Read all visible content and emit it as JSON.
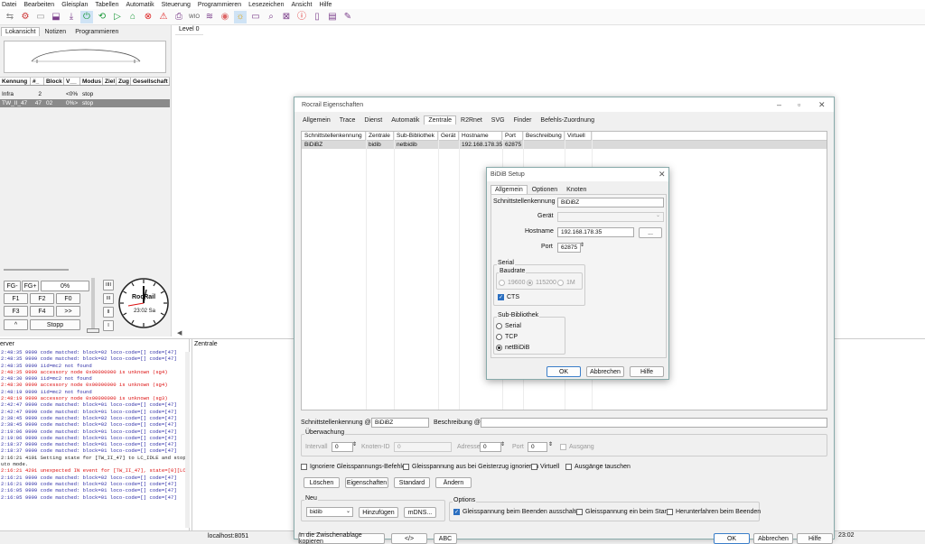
{
  "menu": [
    "Datei",
    "Bearbeiten",
    "Gleisplan",
    "Tabellen",
    "Automatik",
    "Steuerung",
    "Programmieren",
    "Lesezeichen",
    "Ansicht",
    "Hilfe"
  ],
  "toolbar_icons": [
    "link-icon",
    "folder-icon",
    "open-icon",
    "save-icon",
    "download-icon",
    "power-icon",
    "refresh-icon",
    "play-icon",
    "home-icon",
    "stop-icon",
    "warning-icon",
    "print-icon",
    "wio-icon",
    "sliders-icon",
    "eye-icon",
    "sun-icon",
    "monitor-icon",
    "search-icon",
    "grid-icon",
    "info-icon",
    "clipboard-icon",
    "archive-icon",
    "edit-icon"
  ],
  "left_tabs": [
    "Lokansicht",
    "Notizen",
    "Programmieren"
  ],
  "loco_table": {
    "headers": [
      "Kennung",
      "#_",
      "Block",
      "V__",
      "Modus",
      "Ziel",
      "Zug",
      "Gesellschaft"
    ],
    "rows": [
      {
        "id": "Infra",
        "num": "2",
        "block": "",
        "v": "<0%",
        "mode": "stop"
      },
      {
        "id": "TW_II_47",
        "num": "47",
        "block": "02",
        "v": "0%>",
        "mode": "stop"
      }
    ]
  },
  "controls": {
    "fg_minus": "FG-",
    "fg_plus": "FG+",
    "speed": "0%",
    "f1": "F1",
    "f2": "F2",
    "f0": "F0",
    "f3": "F3",
    "f4": "F4",
    "next": ">>",
    "up": "^",
    "stop": "Stopp",
    "gear_levels": [
      "IIII",
      "III",
      "II",
      "I"
    ],
    "clock_time": "23:02 Sa",
    "clock_label": "RocRail"
  },
  "level_tab": "Level 0",
  "server_label": "erver",
  "zentrale_label": "Zentrale",
  "log": [
    {
      "t": "2:48:35 9999 code matched: block=02 loco-code=[] code=[47]",
      "c": "blue"
    },
    {
      "t": "2:48:35 9999 code matched: block=02 loco-code=[] code=[47]",
      "c": "blue"
    },
    {
      "t": "2:48:35 9999 iid=mc2 not found",
      "c": "blue"
    },
    {
      "t": "2:48:35 9999 accessory node 0x00000000 is unknown (sg4)",
      "c": "red"
    },
    {
      "t": "2:48:30 9999 iid=mc2 not found",
      "c": "blue"
    },
    {
      "t": "2:48:30 9999 accessory node 0x00000000 is unknown (sg4)",
      "c": "red"
    },
    {
      "t": "2:48:19 9999 iid=mc2 not found",
      "c": "blue"
    },
    {
      "t": "2:48:19 9999 accessory node 0x00000000 is unknown (sg3)",
      "c": "red"
    },
    {
      "t": "2:42:47 9999 code matched: block=01 loco-code=[] code=[47]",
      "c": "blue"
    },
    {
      "t": "2:42:47 9999 code matched: block=01 loco-code=[] code=[47]",
      "c": "blue"
    },
    {
      "t": "2:38:45 9999 code matched: block=02 loco-code=[] code=[47]",
      "c": "blue"
    },
    {
      "t": "2:38:45 9999 code matched: block=02 loco-code=[] code=[47]",
      "c": "blue"
    },
    {
      "t": "2:19:06 9999 code matched: block=01 loco-code=[] code=[47]",
      "c": "blue"
    },
    {
      "t": "2:19:06 9999 code matched: block=01 loco-code=[] code=[47]",
      "c": "blue"
    },
    {
      "t": "2:18:37 9999 code matched: block=01 loco-code=[] code=[47]",
      "c": "blue"
    },
    {
      "t": "2:18:37 9999 code matched: block=01 loco-code=[] code=[47]",
      "c": "blue"
    },
    {
      "t": "2:16:21 4101 Setting state for [TW_II_47] to LC_IDLE and stop running",
      "c": "dark"
    },
    {
      "t": "uto mode.",
      "c": "dark"
    },
    {
      "t": "2:16:21 4201 unexpected IN event for [TW_II_47], state=[0][LC_IDLE]",
      "c": "red"
    },
    {
      "t": "2:16:21 9999 code matched: block=02 loco-code=[] code=[47]",
      "c": "blue"
    },
    {
      "t": "2:16:21 9999 code matched: block=02 loco-code=[] code=[47]",
      "c": "blue"
    },
    {
      "t": "2:16:05 9999 code matched: block=01 loco-code=[] code=[47]",
      "c": "blue"
    },
    {
      "t": "2:16:05 9999 code matched: block=01 loco-code=[] code=[47]",
      "c": "blue"
    }
  ],
  "status": {
    "host": "localhost:8051",
    "clock": "23:02"
  },
  "props": {
    "title": "Rocrail Eigenschaften",
    "tabs": [
      "Allgemein",
      "Trace",
      "Dienst",
      "Automatik",
      "Zentrale",
      "R2Rnet",
      "SVG",
      "Finder",
      "Befehls-Zuordnung"
    ],
    "grid_headers": [
      "Schnittstellenkennung",
      "Zentrale",
      "Sub-Bibliothek",
      "Gerät",
      "Hostname",
      "Port",
      "Beschreibung",
      "Virtuell"
    ],
    "grid_row": [
      "BiDiBZ",
      "bidib",
      "netbidib",
      "",
      "192.168.178.35",
      "62875",
      "",
      ""
    ],
    "iid_label": "Schnittstellenkennung @",
    "iid_value": "BiDiBZ",
    "desc_label": "Beschreibung @",
    "desc_value": "",
    "monitor_label": "Überwachung",
    "interval_label": "Intervall",
    "interval_value": "0",
    "node_label": "Knoten-ID",
    "node_value": "0",
    "address_label": "Adresse",
    "address_value": "0",
    "port_label": "Port",
    "port_value": "0",
    "output_label": "Ausgang",
    "ignore_power": "Ignoriere Gleisspannungs-Befehle",
    "power_off_ghost": "Gleisspannung aus bei Geisterzug ignorieren",
    "virtual": "Virtuell",
    "swap_outputs": "Ausgänge tauschen",
    "delete": "Löschen",
    "properties": "Eigenschaften",
    "standard": "Standard",
    "change": "Ändern",
    "new_label": "Neu",
    "new_value": "bidib",
    "add": "Hinzufügen",
    "mdns": "mDNS...",
    "options_label": "Options",
    "opt1": "Gleisspannung beim Beenden ausschalten",
    "opt2": "Gleisspannung ein beim Start",
    "opt3": "Herunterfahren beim Beenden",
    "copy": "In die Zwischenablage kopieren",
    "code": "</>",
    "abc": "ABC",
    "ok": "OK",
    "cancel": "Abbrechen",
    "help": "Hilfe"
  },
  "bidib": {
    "title": "BiDiB Setup",
    "tabs": [
      "Allgemein",
      "Optionen",
      "Knoten"
    ],
    "iid_label": "Schnittstellenkennung",
    "iid_value": "BiDiBZ",
    "device_label": "Gerät",
    "device_value": "",
    "host_label": "Hostname",
    "host_value": "192.168.178.35",
    "browse": "...",
    "port_label": "Port",
    "port_value": "62875",
    "serial_label": "Serial",
    "baud_label": "Baudrate",
    "baud1": "19600",
    "baud2": "115200",
    "baud3": "1M",
    "cts": "CTS",
    "sub_label": "Sub-Bibliothek",
    "sub1": "Serial",
    "sub2": "TCP",
    "sub3": "netBiDiB",
    "ok": "OK",
    "cancel": "Abbrechen",
    "help": "Hilfe"
  }
}
